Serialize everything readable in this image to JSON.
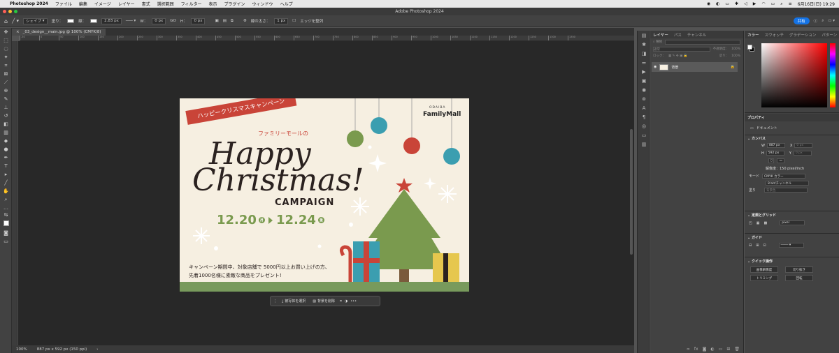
{
  "menubar": {
    "app": "Photoshop 2024",
    "items": [
      "ファイル",
      "編集",
      "イメージ",
      "レイヤー",
      "書式",
      "選択範囲",
      "フィルター",
      "表示",
      "プラグイン",
      "ウィンドウ",
      "ヘルプ"
    ],
    "clock": "6月16日(日)  19:29"
  },
  "window": {
    "title": "Adobe Photoshop 2024"
  },
  "options": {
    "mode": "シェイプ",
    "fill_label": "塗り：",
    "stroke_label": "線：",
    "stroke_width": "2.83 px",
    "w_label": "W：",
    "w_value": "0 px",
    "link_label": "GO",
    "h_label": "H：",
    "h_value": "0 px",
    "weight_label": "線の太さ：",
    "weight_value": "1 px",
    "align_edges": "エッジを整列",
    "share": "共有"
  },
  "document": {
    "tab": "_03_design__main.jpg @ 100% (CMYK/8)",
    "zoom": "100%",
    "info": "887 px x 592 px (150 ppi)"
  },
  "ruler": {
    "marks": [
      "-50",
      "0",
      "50",
      "100",
      "150",
      "200",
      "250",
      "300",
      "350",
      "400",
      "450",
      "500",
      "550",
      "600",
      "650",
      "700",
      "750",
      "800",
      "850",
      "900",
      "950",
      "1000",
      "1050",
      "1100",
      "1150",
      "1200",
      "1250",
      "1300",
      "1350"
    ]
  },
  "artwork": {
    "ribbon": "ハッピークリスマスキャンペーン",
    "brand_small": "ODAIBA",
    "brand": "FamilyMall",
    "sub": "ファミリーモールの",
    "happy": "Happy",
    "christmas": "Christmas!",
    "campaign": "CAMPAIGN",
    "date_start": "12.20",
    "dow_start": "月",
    "date_end": "12.24",
    "dow_end": "金",
    "desc_line1": "キャンペーン期間中、対象店舗で 5000円以上お買い上げの方、",
    "desc_line2": "先着1000名様に素敵な商品をプレゼント!"
  },
  "floatbar": {
    "select_subject": "被写体を選択",
    "remove_bg": "背景を削除"
  },
  "layers": {
    "tabs": [
      "レイヤー",
      "パス",
      "チャンネル"
    ],
    "filter_label": "種類",
    "blend_mode": "通常",
    "opacity_label": "不透明度：",
    "opacity": "100%",
    "lock_label": "ロック：",
    "fill_label": "塗り：",
    "fill": "100%",
    "layer_name": "背景"
  },
  "color_panel": {
    "tabs": [
      "カラー",
      "スウォッチ",
      "グラデーション",
      "パターン"
    ]
  },
  "properties": {
    "title": "プロパティ",
    "doc_label": "ドキュメント",
    "canvas_title": "カンバス",
    "w_label": "W",
    "w_value": "887 px",
    "x_label": "X",
    "x_value": "0 px",
    "h_label": "H",
    "h_value": "592 px",
    "y_label": "Y",
    "y_value": "0 px",
    "resolution": "解像度：150 pixel/inch",
    "mode_label": "モード",
    "mode": "CMYK カラー",
    "bits": "8 bit/チャンネル",
    "fill_label": "塗り",
    "fill_value": "背景色",
    "rulers_title": "定規とグリッド",
    "unit": "pixel",
    "guides_title": "ガイド",
    "quick_title": "クイック操作",
    "quick_buttons": [
      "画像解像度",
      "切り抜き",
      "トリミング",
      "回転"
    ]
  },
  "colors": {
    "accent": "#1473e6",
    "red": "#c94438",
    "green": "#7a9a4e",
    "cream": "#f6efe1"
  }
}
